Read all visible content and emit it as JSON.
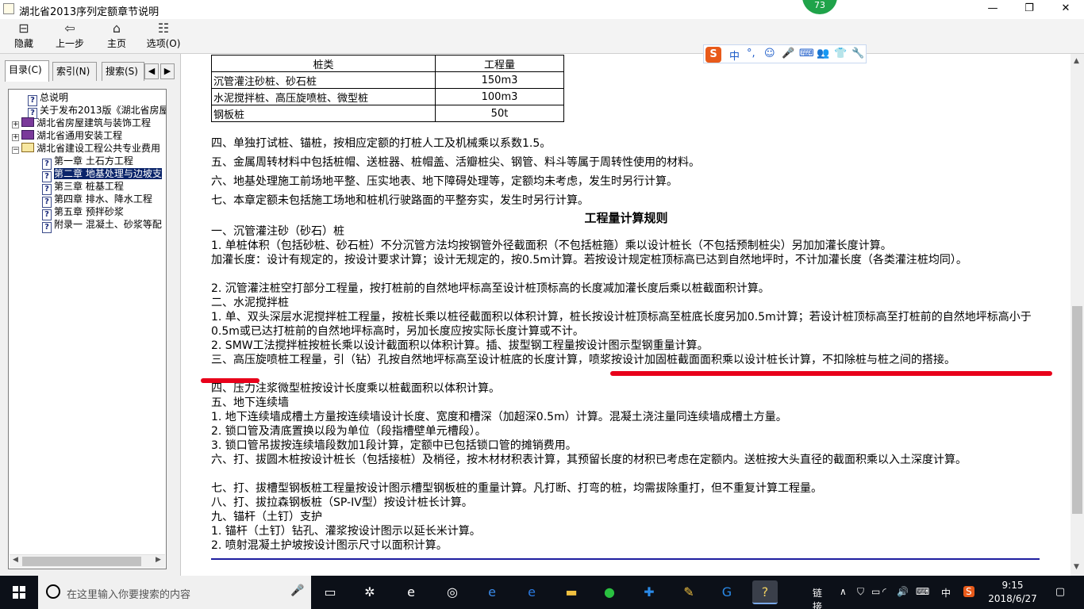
{
  "window": {
    "title": "湖北省2013序列定额章节说明",
    "badge": "73",
    "minimize": "—",
    "restore": "❐",
    "close": "✕"
  },
  "toolbar": {
    "hide": "隐藏",
    "back": "上一步",
    "home": "主页",
    "options": "选项(O)",
    "icons": {
      "hide": "⊟",
      "back": "⇦",
      "home": "⌂",
      "options": "☷"
    }
  },
  "tabs": {
    "contents": "目录(C)",
    "index": "索引(N)",
    "search": "搜索(S)",
    "prev": "◀",
    "next": "▶"
  },
  "tree": [
    {
      "label": "总说明",
      "type": "page"
    },
    {
      "label": "关于发布2013版《湖北省房屋",
      "type": "page"
    },
    {
      "label": "湖北省房屋建筑与装饰工程",
      "type": "book",
      "exp": "+"
    },
    {
      "label": "湖北省通用安装工程",
      "type": "book",
      "exp": "+"
    },
    {
      "label": "湖北省建设工程公共专业费用",
      "type": "book-open",
      "exp": "−"
    },
    {
      "label": "第一章 土石方工程",
      "type": "page",
      "indent": true
    },
    {
      "label": "第二章 地基处理与边坡支",
      "type": "page",
      "indent": true,
      "selected": true
    },
    {
      "label": "第三章 桩基工程",
      "type": "page",
      "indent": true
    },
    {
      "label": "第四章 排水、降水工程",
      "type": "page",
      "indent": true
    },
    {
      "label": "第五章 预拌砂浆",
      "type": "page",
      "indent": true
    },
    {
      "label": "附录一 混凝土、砂浆等配",
      "type": "page",
      "indent": true
    }
  ],
  "table": {
    "headers": [
      "桩类",
      "工程量"
    ],
    "rows": [
      [
        "沉管灌注砂桩、砂石桩",
        "150m3"
      ],
      [
        "水泥搅拌桩、高压旋喷桩、微型桩",
        "100m3"
      ],
      [
        "钢板桩",
        "50t"
      ]
    ]
  },
  "notes": [
    "四、单独打试桩、锚桩，按相应定额的打桩人工及机械乘以系数1.5。",
    "五、金属周转材料中包括桩帽、送桩器、桩帽盖、活瓣桩尖、钢管、料斗等属于周转性使用的材料。",
    "六、地基处理施工前场地平整、压实地表、地下障碍处理等，定额均未考虑，发生时另行计算。",
    "七、本章定额未包括施工场地和桩机行驶路面的平整夯实，发生时另行计算。"
  ],
  "rules_title": "工程量计算规则",
  "rules": [
    "一、沉管灌注砂（砂石）桩",
    "1. 单桩体积（包括砂桩、砂石桩）不分沉管方法均按钢管外径截面积（不包括桩箍）乘以设计桩长（不包括预制桩尖）另加加灌长度计算。",
    "加灌长度：设计有规定的，按设计要求计算；设计无规定的，按0.5m计算。若按设计规定桩顶标高已达到自然地坪时，不计加灌长度（各类灌注桩均同）。",
    "2. 沉管灌注桩空打部分工程量，按打桩前的自然地坪标高至设计桩顶标高的长度减加灌长度后乘以桩截面积计算。",
    "二、水泥搅拌桩",
    "1. 单、双头深层水泥搅拌桩工程量，按桩长乘以桩径截面积以体积计算，桩长按设计桩顶标高至桩底长度另加0.5m计算；若设计桩顶标高至打桩前的自然地坪标高小于0.5m或已达打桩前的自然地坪标高时，另加长度应按实际长度计算或不计。",
    "2. SMW工法搅拌桩按桩长乘以设计截面积以体积计算。插、拔型钢工程量按设计图示型钢重量计算。",
    "三、高压旋喷桩工程量，引（钻）孔按自然地坪标高至设计桩底的长度计算，喷浆按设计加固桩截面面积乘以设计桩长计算，不扣除桩与桩之间的搭接。",
    "四、压力注浆微型桩按设计长度乘以桩截面积以体积计算。",
    "五、地下连续墙",
    "1. 地下连续墙成槽土方量按连续墙设计长度、宽度和槽深（加超深0.5m）计算。混凝土浇注量同连续墙成槽土方量。",
    "2. 锁口管及清底置换以段为单位（段指槽壁单元槽段）。",
    "3. 锁口管吊拔按连续墙段数加1段计算，定额中已包括锁口管的摊销费用。",
    "六、打、拔圆木桩按设计桩长（包括接桩）及梢径，按木材材积表计算，其预留长度的材积已考虑在定额内。送桩按大头直径的截面积乘以入土深度计算。",
    "七、打、拔槽型钢板桩工程量按设计图示槽型钢板桩的重量计算。凡打断、打弯的桩，均需拔除重打，但不重复计算工程量。",
    "八、打、拔拉森钢板桩（SP-IV型）按设计桩长计算。",
    "九、锚杆（土钉）支护",
    "1. 锚杆（土钉）钻孔、灌浆按设计图示以延长米计算。",
    "2. 喷射混凝土护坡按设计图示尺寸以面积计算。"
  ],
  "ime": {
    "logo": "S",
    "lang": "中",
    "punct": "°,",
    "icons": [
      "☺",
      "🎤",
      "⌨",
      "👥",
      "👕",
      "🔧"
    ]
  },
  "taskbar": {
    "search_placeholder": "在这里输入你要搜索的内容",
    "mic": "🎤",
    "apps": [
      "▭",
      "✲",
      "e",
      "◎",
      "e",
      "e",
      "▬",
      "●",
      "✚",
      "✎",
      "G",
      "?"
    ],
    "tray_label": "链接",
    "tray_icons": [
      "∧",
      "⛉",
      "▭",
      "◜",
      "🔊",
      "⌨"
    ],
    "ime_indicator": "中",
    "sogou": "S",
    "time": "9:15",
    "date": "2018/6/27",
    "notification": "▢"
  },
  "colors": {
    "selected_bg": "#0a246a",
    "red_mark": "#e8001a",
    "blue_rule": "#1e1ea0",
    "badge": "#1fa34a",
    "taskbar": "#0c1018"
  }
}
